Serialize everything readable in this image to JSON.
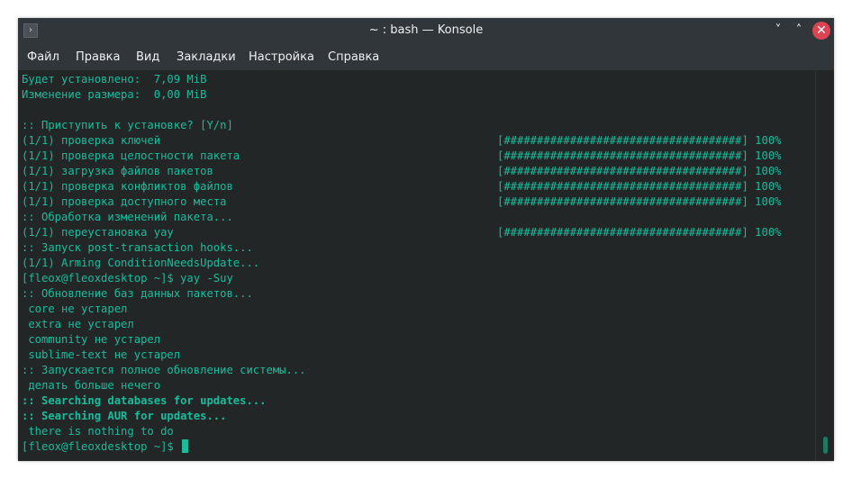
{
  "window": {
    "title": "~ : bash — Konsole",
    "app_icon": "terminal-icon",
    "controls": {
      "minimize": "˅",
      "maximize": "˄",
      "close": "✕"
    }
  },
  "menu": {
    "items": [
      "Файл",
      "Правка",
      "Вид",
      "Закладки",
      "Настройка",
      "Справка"
    ]
  },
  "colors": {
    "terminal_bg": "#232627",
    "terminal_text": "#1abc9c",
    "chrome_bg": "#31363b",
    "close_button": "#da4453"
  },
  "terminal": {
    "lines": [
      "Будет установлено:  7,09 MiB",
      "Изменение размера:  0,00 MiB",
      "",
      ":: Приступить к установке? [Y/n]",
      "(1/1) проверка ключей",
      "(1/1) проверка целостности пакета",
      "(1/1) загрузка файлов пакетов",
      "(1/1) проверка конфликтов файлов",
      "(1/1) проверка доступного места",
      ":: Обработка изменений пакета...",
      "(1/1) переустановка yay",
      ":: Запуск post-transaction hooks...",
      "(1/1) Arming ConditionNeedsUpdate...",
      "[fleox@fleoxdesktop ~]$ yay -Suy",
      ":: Обновление баз данных пакетов...",
      " core не устарел",
      " extra не устарел",
      " community не устарел",
      " sublime-text не устарел",
      ":: Запускается полное обновление системы...",
      " делать больше нечего",
      ":: Searching databases for updates...",
      ":: Searching AUR for updates...",
      " there is nothing to do",
      "[fleox@fleoxdesktop ~]$ "
    ],
    "progress": {
      "bar": "[####################################]",
      "percent": "100%"
    }
  }
}
